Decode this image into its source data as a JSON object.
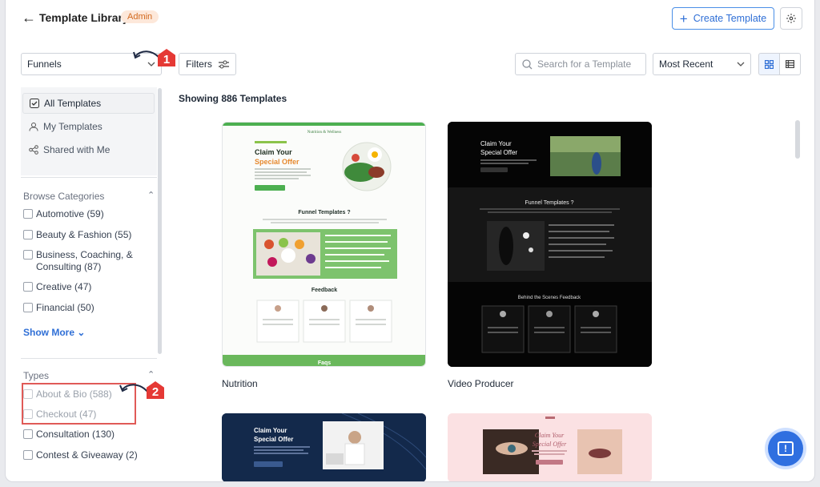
{
  "header": {
    "back_icon": "arrow-left-icon",
    "title": "Template Library",
    "badge": "Admin",
    "create_button": "Create Template",
    "settings_icon": "gear-icon"
  },
  "toolbar": {
    "type_select": "Funnels",
    "filters_label": "Filters",
    "search_placeholder": "Search for a Template",
    "sort_value": "Most Recent",
    "view_grid_icon": "grid-view-icon",
    "view_list_icon": "list-view-icon"
  },
  "callouts": [
    "1",
    "2"
  ],
  "sidebar": {
    "nav": [
      "All Templates",
      "My Templates",
      "Shared with Me"
    ],
    "browse_title": "Browse Categories",
    "categories": [
      "Automotive (59)",
      "Beauty & Fashion (55)",
      "Business, Coaching, & Consulting (87)",
      "Creative (47)",
      "Financial (50)"
    ],
    "show_more": "Show More",
    "types_title": "Types",
    "types": [
      "About & Bio (588)",
      "Checkout (47)",
      "Consultation (130)",
      "Contest & Giveaway (2)"
    ]
  },
  "main": {
    "count": "Showing 886 Templates",
    "cards": [
      {
        "label": "Nutrition",
        "brand": "Nutrition & Wellness",
        "headline1": "Claim Your",
        "headline2": "Special Offer",
        "section1": "Funnel Templates ?",
        "section2": "Feedback",
        "footer": "Faqs",
        "accent": "#4caf50"
      },
      {
        "label": "Video Producer",
        "headline1": "Claim Your",
        "headline2": "Special Offer",
        "section1": "Funnel Templates ?",
        "section2": "Behind the Scenes Feedback"
      },
      {
        "headline1": "Claim Your",
        "headline2": "Special Offer"
      },
      {
        "headline1": "Claim Your",
        "headline2": "Special Offer"
      }
    ]
  },
  "help_icon": "help-chat-icon",
  "colors": {
    "accent": "#2f6fd6",
    "badge_bg": "#fde8da",
    "badge_text": "#d2691e",
    "callout": "#e53935"
  }
}
